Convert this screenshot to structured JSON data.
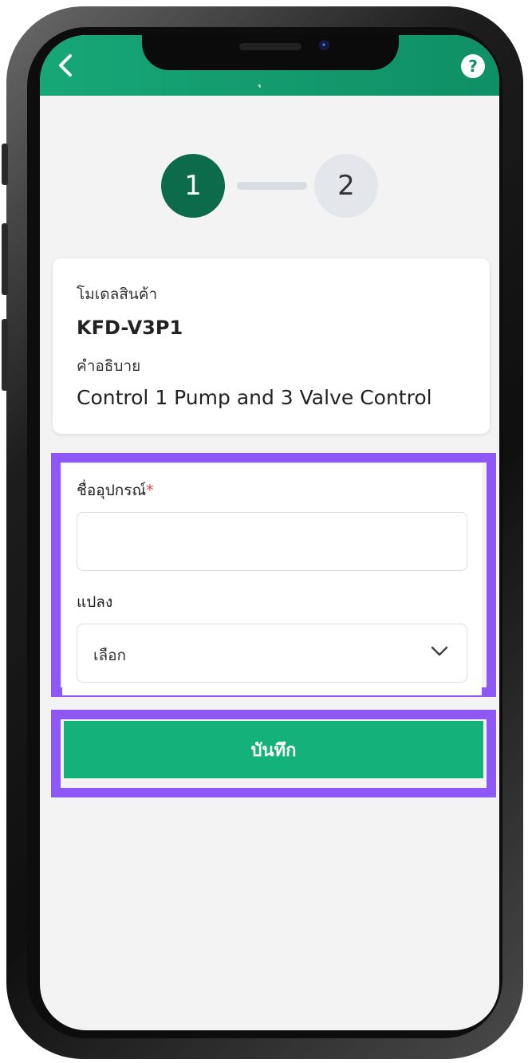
{
  "header": {
    "title_fragment": "ุ",
    "help_label": "?"
  },
  "stepper": {
    "steps": [
      "1",
      "2"
    ],
    "active_step": 1
  },
  "product": {
    "model_label": "โมเดลสินค้า",
    "model_value": "KFD-V3P1",
    "description_label": "คำอธิบาย",
    "description_value": "Control 1 Pump and 3 Valve Control"
  },
  "form": {
    "device_name_label": "ชื่ออุปกรณ์",
    "required_mark": "*",
    "device_name_value": "",
    "plot_label": "แปลง",
    "plot_selected": "เลือก"
  },
  "actions": {
    "save_label": "บันทึก"
  },
  "colors": {
    "header_green": "#17a777",
    "active_step": "#0c6b4a",
    "save_button": "#14b17a",
    "highlight": "#8d58f5",
    "required": "#e04040"
  },
  "icons": [
    "back-arrow-icon",
    "help-icon",
    "chevron-down-icon"
  ]
}
